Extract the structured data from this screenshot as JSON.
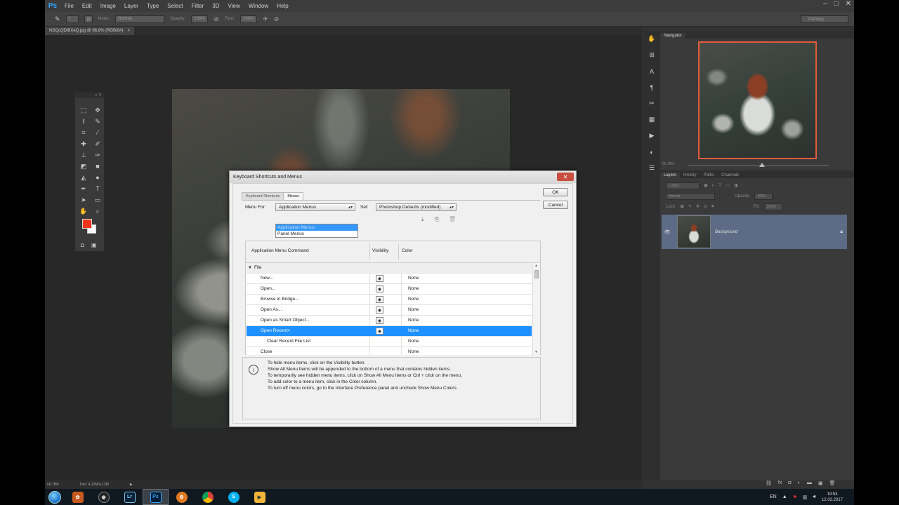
{
  "app": {
    "logo": "Ps",
    "menus": [
      "File",
      "Edit",
      "Image",
      "Layer",
      "Type",
      "Select",
      "Filter",
      "3D",
      "View",
      "Window",
      "Help"
    ],
    "window_controls": [
      "–",
      "□",
      "✕"
    ]
  },
  "options_bar": {
    "mode_label": "Mode:",
    "mode_value": "Normal",
    "opacity_label": "Opacity:",
    "opacity_value": "100%",
    "flow_label": "Flow:",
    "flow_value": "100%",
    "workspace": "Painting"
  },
  "document": {
    "tab_title": "NSQcQDlBXeQ.jpg @ 66,8% (RGB/8#)",
    "tab_close": "×"
  },
  "status": {
    "zoom": "66,78%",
    "doc_size": "Doc: 4,12M/4,12M"
  },
  "panels": {
    "navigator_tab": "Navigator",
    "navigator_zoom": "66,78%",
    "layer_tabs": [
      "Layers",
      "History",
      "Paths",
      "Channels"
    ],
    "kind_filter": "Kind",
    "blend_mode": "Normal",
    "opacity_label": "Opacity:",
    "opacity_value": "100%",
    "lock_label": "Lock:",
    "fill_label": "Fill:",
    "fill_value": "100%",
    "layer_name": "Background"
  },
  "dialog": {
    "title": "Keyboard Shortcuts and Menus",
    "close": "✕",
    "tabs": [
      "Keyboard Shortcuts",
      "Menus"
    ],
    "ok_label": "OK",
    "cancel_label": "Cancel",
    "menu_for_label": "Menu For:",
    "menu_for_value": "Application Menus",
    "menu_for_options": [
      "Application Menus",
      "Panel Menus"
    ],
    "set_label": "Set:",
    "set_value": "Photoshop Defaults (modified)",
    "columns": [
      "Application Menu Command",
      "Visibility",
      "Color"
    ],
    "rows": [
      {
        "command": "File",
        "group": true,
        "visible": false,
        "color": ""
      },
      {
        "command": "New...",
        "group": false,
        "visible": true,
        "color": "None"
      },
      {
        "command": "Open...",
        "group": false,
        "visible": true,
        "color": "None"
      },
      {
        "command": "Browse in Bridge...",
        "group": false,
        "visible": true,
        "color": "None"
      },
      {
        "command": "Open As...",
        "group": false,
        "visible": true,
        "color": "None"
      },
      {
        "command": "Open as Smart Object...",
        "group": false,
        "visible": true,
        "color": "None"
      },
      {
        "command": "Open Recent>",
        "group": false,
        "visible": true,
        "color": "None",
        "selected": true
      },
      {
        "command": "Clear Recent File List",
        "group": false,
        "visible": false,
        "color": "None",
        "indent": true
      },
      {
        "command": "Close",
        "group": false,
        "visible": false,
        "color": "None"
      }
    ],
    "info_lines": [
      "To hide menu items, click on the Visibility button.",
      "Show All Menu Items will be appended to the bottom of a menu that contains hidden items.",
      "To temporarily see hidden menu items, click on Show All Menu Items or Ctrl + click on the menu.",
      "To add color to a menu item, click in the Color column.",
      "To turn off menu colors, go to the Interface Preference panel and uncheck Show Menu Colors."
    ]
  },
  "taskbar": {
    "apps": [
      "Lr",
      "Ps",
      "S"
    ],
    "language": "EN",
    "time": "19:53",
    "date": "12.02.2017"
  }
}
